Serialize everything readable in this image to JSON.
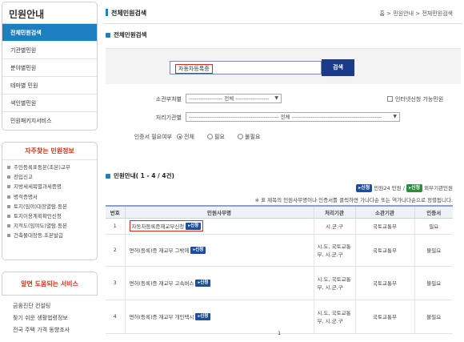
{
  "sidebar": {
    "title": "민원안내",
    "items": [
      {
        "label": "전체민원검색"
      },
      {
        "label": "기관별민원"
      },
      {
        "label": "분야별민원"
      },
      {
        "label": "테마별 민원"
      },
      {
        "label": "색인별민원"
      },
      {
        "label": "민원패키지서비스"
      }
    ],
    "freq_title": "자주찾는 민원정보",
    "freq_items": [
      "주민등록표등본(초본)교부",
      "전입신고",
      "지방세세목별과세증명",
      "병적증명서",
      "토지(임야)대장열람.등본",
      "토지이용계획확인신청",
      "지적도(임야도)열람.등본",
      "건축물대장등.초본발급"
    ],
    "services_title": "알면 도움되는 서비스",
    "services": [
      "금융진단 컨설팅",
      "찾기 쉬운 생활법령정보",
      "전국 주택 가격 동향조사"
    ]
  },
  "header": {
    "title": "전체민원검색",
    "breadcrumb": "홈 > 민원안내 > 전체민원검색"
  },
  "search": {
    "section_title": "전체민원검색",
    "value": "자동차등록증",
    "button": "검색",
    "dept_label": "소관부처별",
    "dept_value": "------------------ 전체 ------------------",
    "internet_label": "인터넷신청 가능민원",
    "agency_label": "처리기관별",
    "agency_value": "------------------------------------------------ 전체 ------------------------------------------------",
    "cert_label": "인증서 필요여부",
    "cert_options": [
      "전체",
      "필요",
      "불필요"
    ]
  },
  "list": {
    "title": "민원안내( 1 - 4 / 4건)",
    "legend_badge1": "신청",
    "legend_text1": "민원24 민원 /",
    "legend_badge2": "신청",
    "legend_text2": "외부기관민원",
    "note": "※ 표 제목의 민원사무명이나 인증서를 클릭하면 가나다순 또는 역가나다순으로 정렬됩니다.",
    "headers": [
      "번호",
      "민원사무명",
      "처리기관",
      "소관기관",
      "인증서"
    ],
    "apply_label": "신청",
    "rows": [
      {
        "no": "1",
        "name": "자동차등록증재교부신청",
        "agency": "시.군.구",
        "dept": "국토교통부",
        "cert": "필요"
      },
      {
        "no": "2",
        "name": "면허(등록)증 재교부 그밖에",
        "agency": "시.도, 국토교통부, 시.군.구",
        "dept": "국토교통부",
        "cert": "불필요"
      },
      {
        "no": "3",
        "name": "면허(등록)증 재교부 고속버스",
        "agency": "시.도, 국토교통부, 시.군.구",
        "dept": "국토교통부",
        "cert": "불필요"
      },
      {
        "no": "4",
        "name": "면허(등록)증 재교부 개인택시",
        "agency": "시.도, 국토교통부, 시.군.구",
        "dept": "국토교통부",
        "cert": "불필요"
      }
    ],
    "page": "1"
  },
  "colors": {
    "accent": "#1d7fc0",
    "search_button": "#1a3a8a",
    "highlight": "#e0261b",
    "freq_title": "#d2331a"
  }
}
